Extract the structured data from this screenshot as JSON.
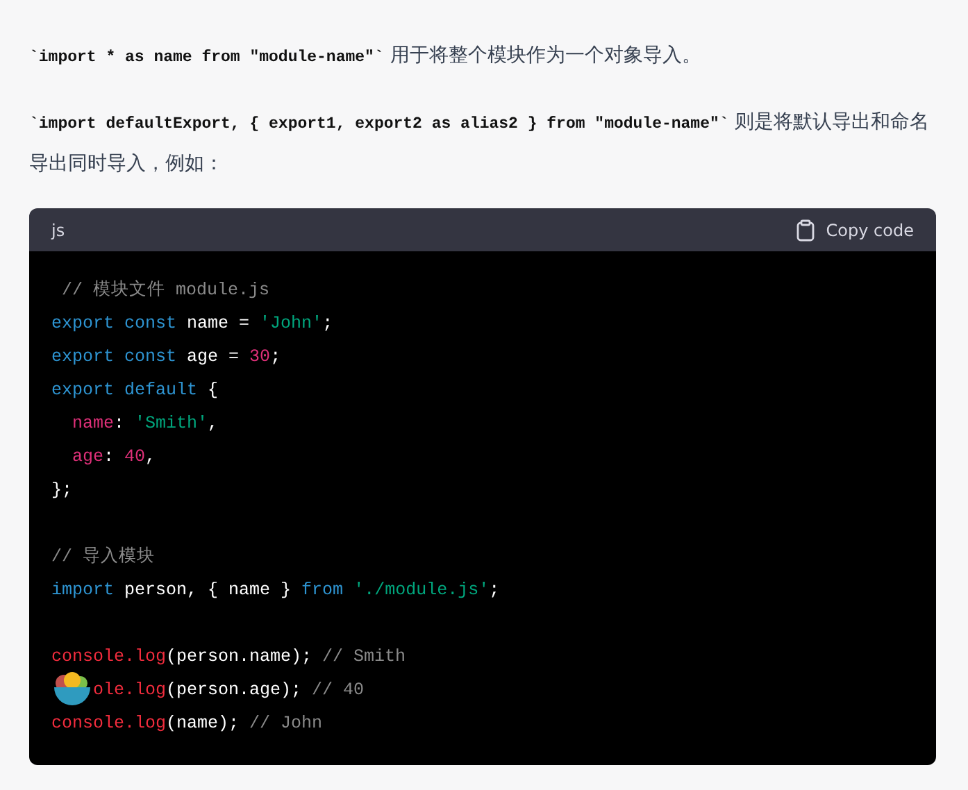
{
  "paragraphs": [
    {
      "code": "`import * as name from \"module-name\"`",
      "text": " 用于将整个模块作为一个对象导入。"
    },
    {
      "code": "`import defaultExport, { export1, export2 as alias2 } from \"module-name\"`",
      "text": " 则是将默认导出和命名导出同时导入，例如："
    }
  ],
  "code_block": {
    "language": "js",
    "copy_label": "Copy code",
    "lines": [
      {
        "kind": "code",
        "tokens": [
          {
            "kind": "comment",
            "text": " // 模块文件 module.js"
          }
        ]
      },
      {
        "kind": "code",
        "tokens": [
          {
            "kind": "keyword",
            "text": "export const "
          },
          {
            "kind": "plain",
            "text": "name = "
          },
          {
            "kind": "string",
            "text": "'John'"
          },
          {
            "kind": "plain",
            "text": ";"
          }
        ]
      },
      {
        "kind": "code",
        "tokens": [
          {
            "kind": "keyword",
            "text": "export const "
          },
          {
            "kind": "plain",
            "text": "age = "
          },
          {
            "kind": "number",
            "text": "30"
          },
          {
            "kind": "plain",
            "text": ";"
          }
        ]
      },
      {
        "kind": "code",
        "tokens": [
          {
            "kind": "keyword",
            "text": "export default "
          },
          {
            "kind": "plain",
            "text": "{"
          }
        ]
      },
      {
        "kind": "code",
        "indent": true,
        "tokens": [
          {
            "kind": "prop",
            "text": "name"
          },
          {
            "kind": "plain",
            "text": ": "
          },
          {
            "kind": "string",
            "text": "'Smith'"
          },
          {
            "kind": "plain",
            "text": ","
          }
        ]
      },
      {
        "kind": "code",
        "indent": true,
        "tokens": [
          {
            "kind": "prop",
            "text": "age"
          },
          {
            "kind": "plain",
            "text": ": "
          },
          {
            "kind": "number",
            "text": "40"
          },
          {
            "kind": "plain",
            "text": ","
          }
        ]
      },
      {
        "kind": "code",
        "tokens": [
          {
            "kind": "plain",
            "text": "};"
          }
        ]
      },
      {
        "kind": "blank"
      },
      {
        "kind": "code",
        "tokens": [
          {
            "kind": "comment",
            "text": "// 导入模块"
          }
        ]
      },
      {
        "kind": "code",
        "tokens": [
          {
            "kind": "keyword",
            "text": "import "
          },
          {
            "kind": "plain",
            "text": "person, { name } "
          },
          {
            "kind": "keyword",
            "text": "from "
          },
          {
            "kind": "string",
            "text": "'./module.js'"
          },
          {
            "kind": "plain",
            "text": ";"
          }
        ]
      },
      {
        "kind": "blank"
      },
      {
        "kind": "code",
        "tokens": [
          {
            "kind": "fn",
            "text": "console.log"
          },
          {
            "kind": "plain",
            "text": "(person.name); "
          },
          {
            "kind": "comment",
            "text": "// Smith"
          }
        ]
      },
      {
        "kind": "covered",
        "tokens": [
          {
            "kind": "fn",
            "text": "ole.log"
          },
          {
            "kind": "plain",
            "text": "(person.age); "
          },
          {
            "kind": "comment",
            "text": "// 40"
          }
        ]
      },
      {
        "kind": "code",
        "tokens": [
          {
            "kind": "fn",
            "text": "console.log"
          },
          {
            "kind": "plain",
            "text": "(name); "
          },
          {
            "kind": "comment",
            "text": "// John"
          }
        ]
      }
    ]
  }
}
